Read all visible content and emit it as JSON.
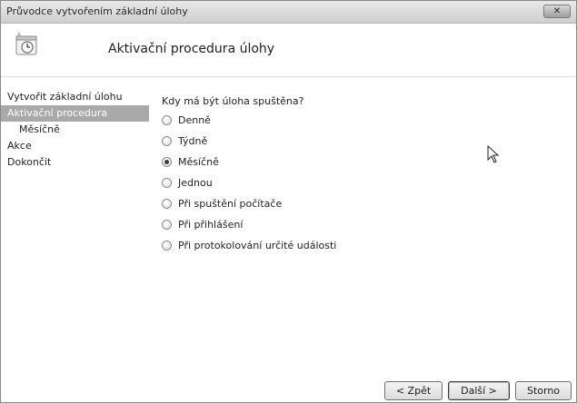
{
  "window": {
    "title": "Průvodce vytvořením základní úlohy",
    "close_label": "✕"
  },
  "header": {
    "title": "Aktivační procedura úlohy",
    "icon": "scheduled-task-clock-icon"
  },
  "sidebar": {
    "items": [
      {
        "label": "Vytvořit základní úlohu",
        "selected": false,
        "sub": false
      },
      {
        "label": "Aktivační procedura",
        "selected": true,
        "sub": false
      },
      {
        "label": "Měsíčně",
        "selected": false,
        "sub": true
      },
      {
        "label": "Akce",
        "selected": false,
        "sub": false
      },
      {
        "label": "Dokončit",
        "selected": false,
        "sub": false
      }
    ]
  },
  "main": {
    "question": "Kdy má být úloha spuštěna?",
    "options": [
      {
        "label": "Denně",
        "checked": false
      },
      {
        "label": "Týdně",
        "checked": false
      },
      {
        "label": "Měsíčně",
        "checked": true
      },
      {
        "label": "Jednou",
        "checked": false
      },
      {
        "label": "Při spuštění počítače",
        "checked": false
      },
      {
        "label": "Při přihlášení",
        "checked": false
      },
      {
        "label": "Při protokolování určité události",
        "checked": false
      }
    ]
  },
  "buttons": {
    "back": "< Zpět",
    "next": "Další >",
    "cancel": "Storno"
  }
}
